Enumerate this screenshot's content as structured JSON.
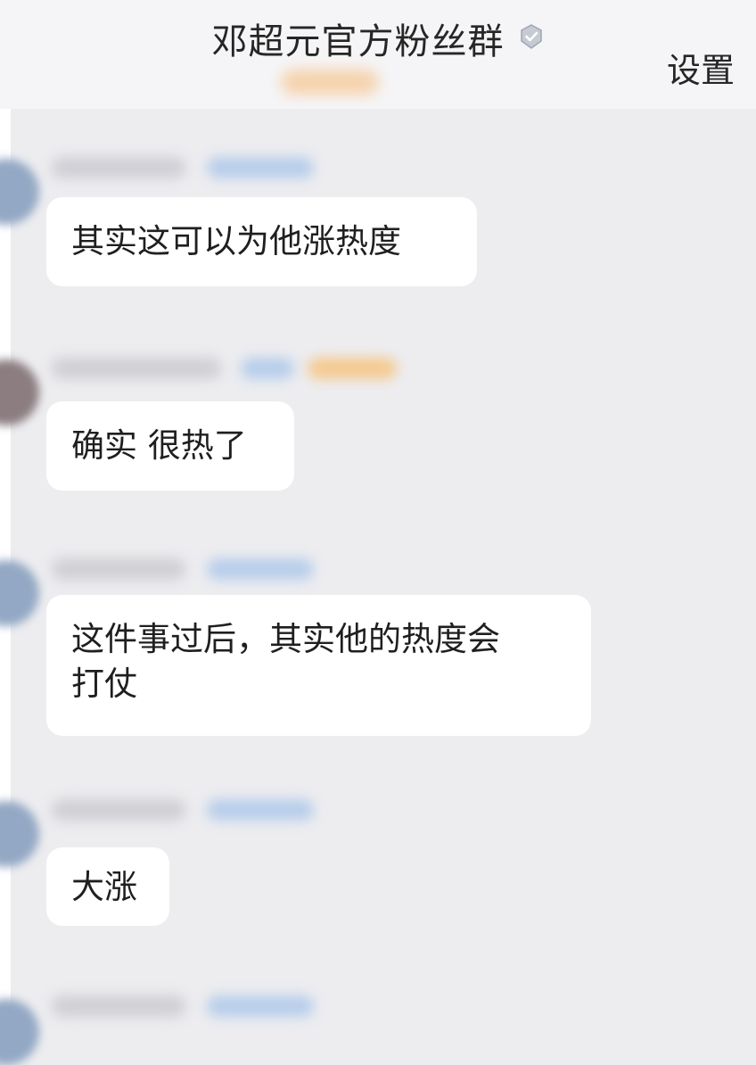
{
  "header": {
    "title": "邓超元官方粉丝群",
    "verified_icon": "verified-check-icon",
    "settings_label": "设置"
  },
  "messages": [
    {
      "text": "其实这可以为他涨热度"
    },
    {
      "text": "确实 很热了"
    },
    {
      "text": "这件事过后，其实他的热度会\n打仗"
    },
    {
      "text": "大涨"
    }
  ],
  "colors": {
    "background": "#ededf0",
    "header_background": "#f5f5f7",
    "bubble": "#ffffff",
    "text": "#1f1f1f"
  }
}
